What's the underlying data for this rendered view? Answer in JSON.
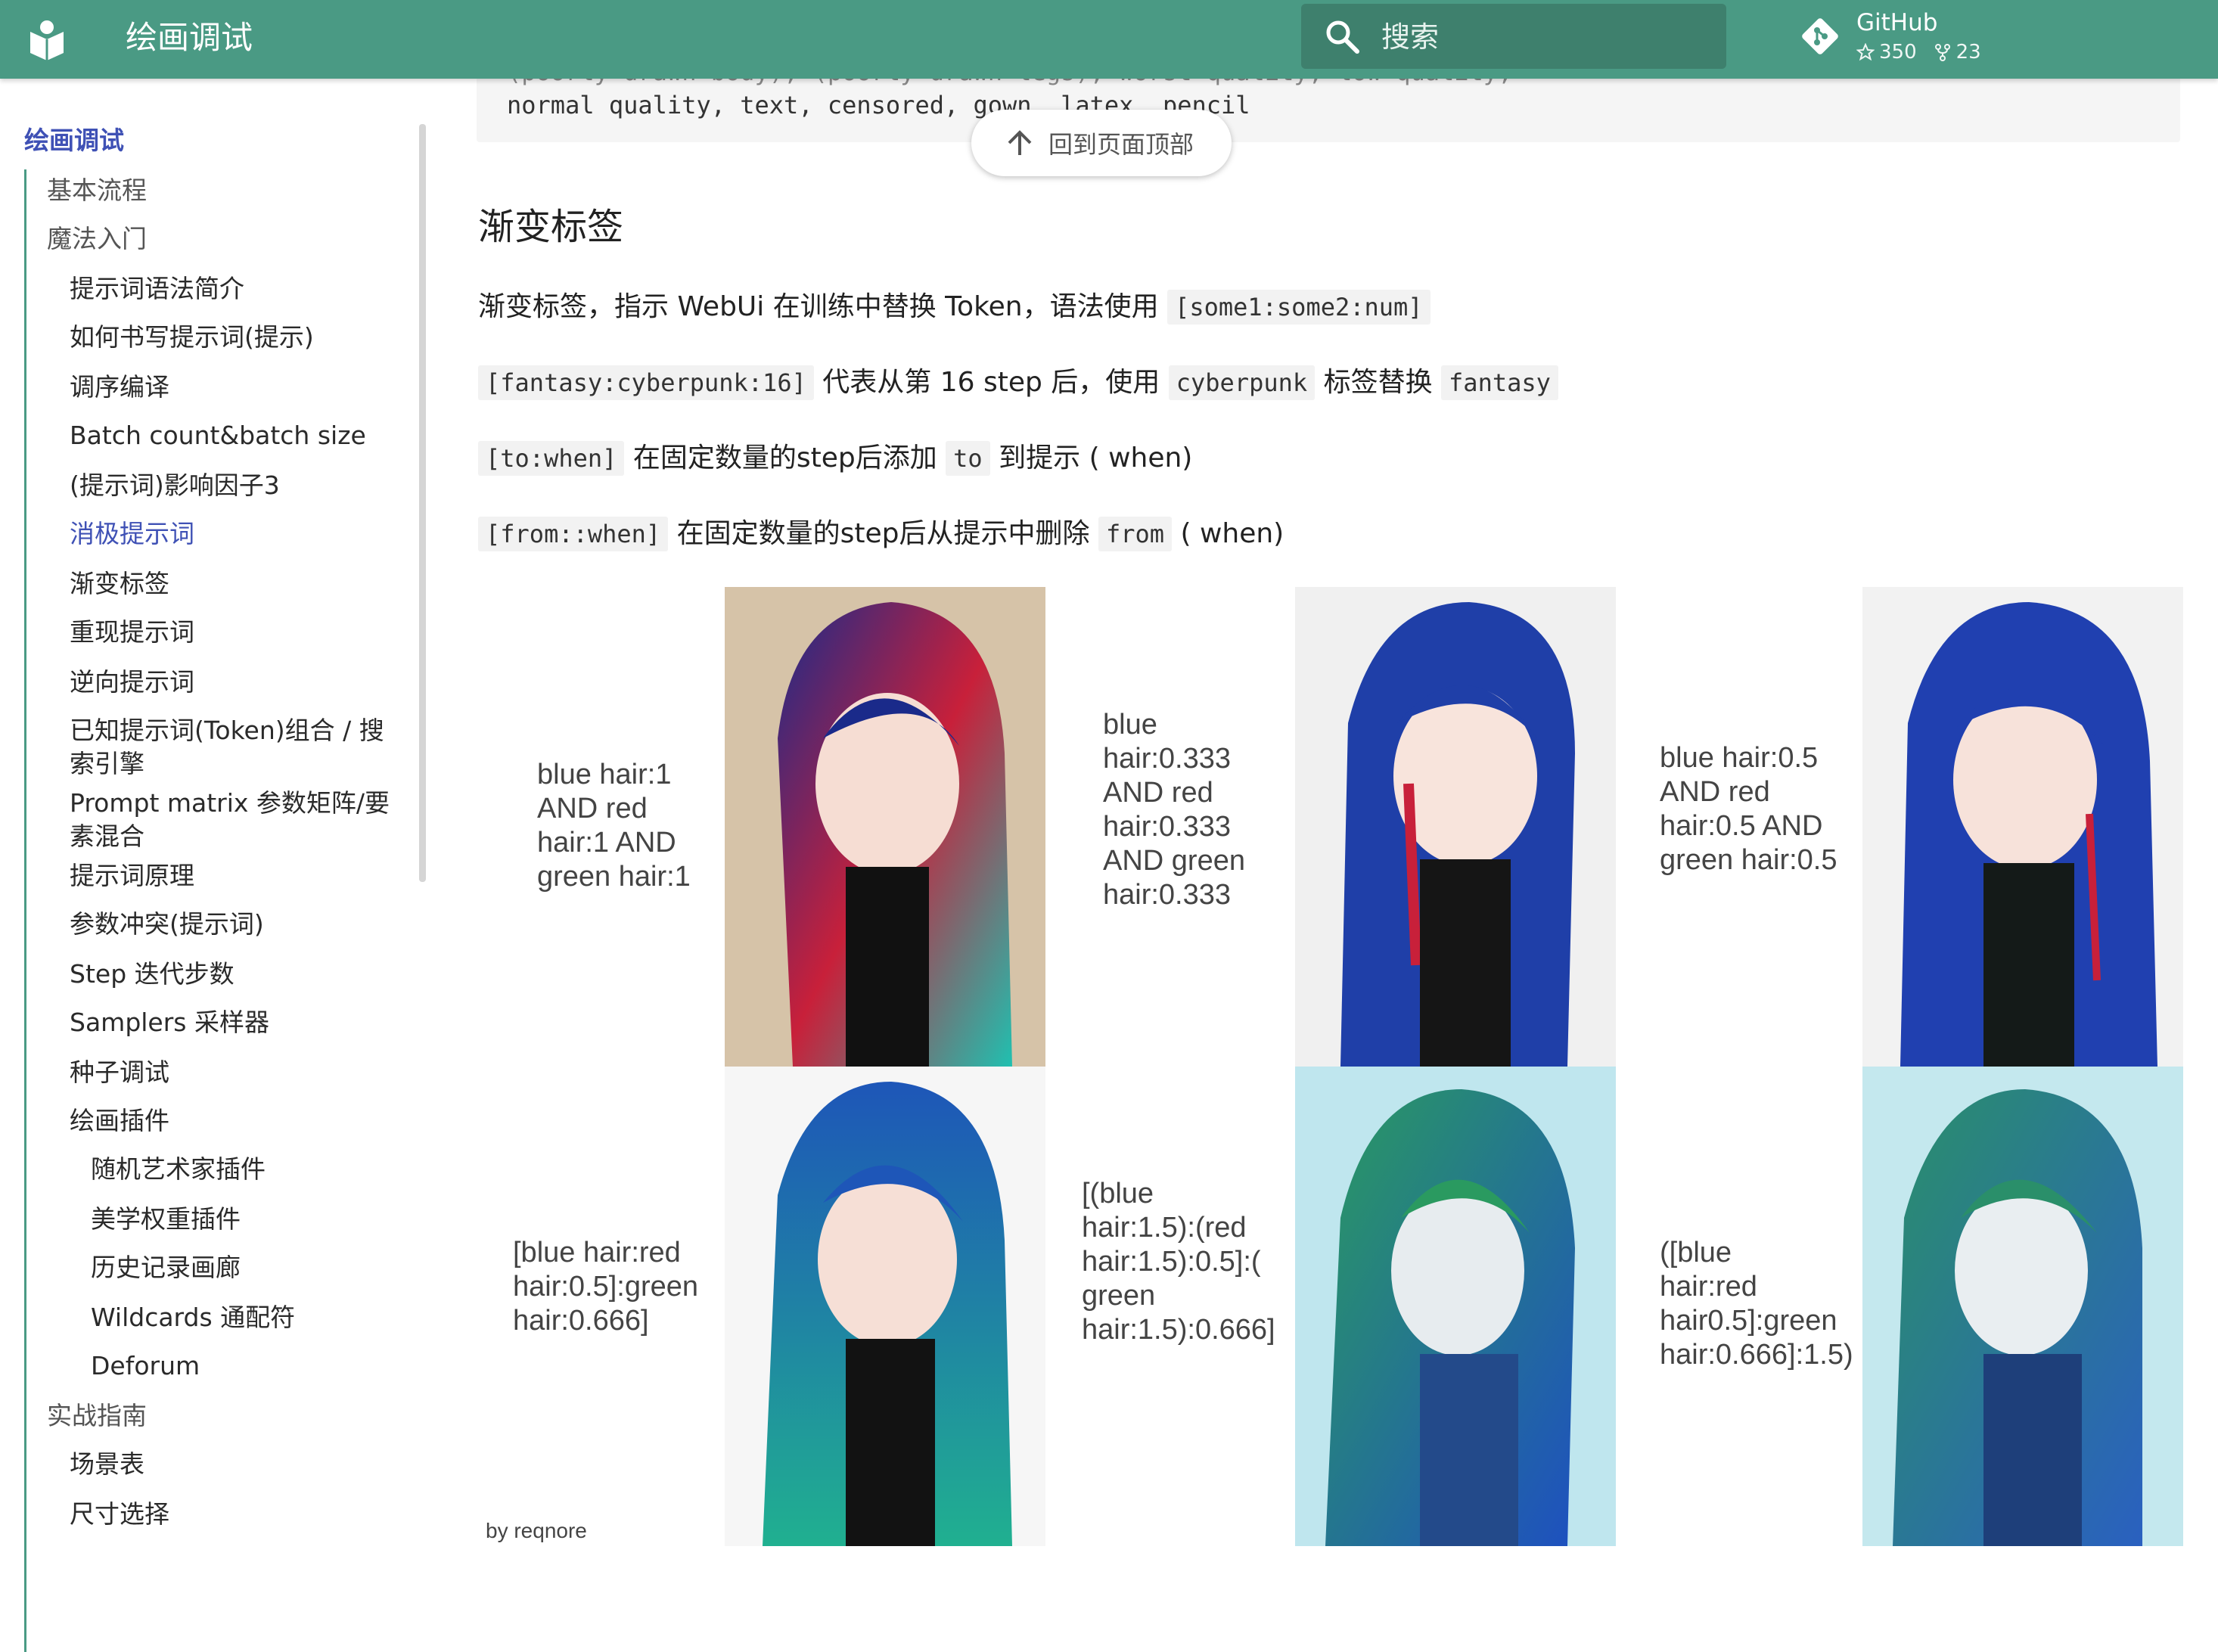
{
  "header": {
    "site_title": "绘画调试",
    "search_placeholder": "搜索",
    "repo": {
      "name": "GitHub",
      "stars": "350",
      "forks": "23"
    }
  },
  "sidebar": {
    "items": [
      {
        "label": "绘画调试",
        "level": 0,
        "active": true
      },
      {
        "label": "基本流程",
        "level": 1
      },
      {
        "label": "魔法入门",
        "level": 1
      },
      {
        "label": "提示词语法简介",
        "level": 2
      },
      {
        "label": "如何书写提示词(提示)",
        "level": 2
      },
      {
        "label": "调序编译",
        "level": 2
      },
      {
        "label": "Batch count&batch size",
        "level": 2
      },
      {
        "label": "(提示词)影响因子3",
        "level": 2
      },
      {
        "label": "消极提示词",
        "level": 2,
        "active": true
      },
      {
        "label": "渐变标签",
        "level": 2
      },
      {
        "label": "重现提示词",
        "level": 2
      },
      {
        "label": "逆向提示词",
        "level": 2
      },
      {
        "label": "已知提示词(Token)组合 / 搜索引擎",
        "level": 2
      },
      {
        "label": "Prompt matrix 参数矩阵/要素混合",
        "level": 2
      },
      {
        "label": "提示词原理",
        "level": 2
      },
      {
        "label": "参数冲突(提示词)",
        "level": 2
      },
      {
        "label": "Step 迭代步数",
        "level": 2
      },
      {
        "label": "Samplers 采样器",
        "level": 2
      },
      {
        "label": "种子调试",
        "level": 2
      },
      {
        "label": "绘画插件",
        "level": 2
      },
      {
        "label": "随机艺术家插件",
        "level": 3
      },
      {
        "label": "美学权重插件",
        "level": 3
      },
      {
        "label": "历史记录画廊",
        "level": 3
      },
      {
        "label": "Wildcards 通配符",
        "level": 3
      },
      {
        "label": "Deforum",
        "level": 3
      },
      {
        "label": "实战指南",
        "level": 1
      },
      {
        "label": "场景表",
        "level": 2
      },
      {
        "label": "尺寸选择",
        "level": 2
      }
    ]
  },
  "content": {
    "code_line_1": "(poorly drawn body), (poorly drawn legs), worst quality, low quality,",
    "code_line_2": "normal quality, text, censored, gown, latex, pencil",
    "back_to_top": "回到页面顶部",
    "section_heading": "渐变标签",
    "p1": {
      "text": "渐变标签，指示 WebUi 在训练中替换 Token，语法使用 ",
      "code": "[some1:some2:num]"
    },
    "p2": {
      "code1": "[fantasy:cyberpunk:16]",
      "text1": " 代表从第 16 step 后，使用 ",
      "code2": "cyberpunk",
      "text2": " 标签替换 ",
      "code3": "fantasy"
    },
    "p3": {
      "code1": "[to:when]",
      "text1": " 在固定数量的step后添加 ",
      "code2": "to",
      "text2": " 到提示 ( when)"
    },
    "p4": {
      "code1": "[from::when]",
      "text1": " 在固定数量的step后从提示中删除 ",
      "code2": "from",
      "text2": " ( when)"
    },
    "grid_labels": [
      "blue hair:1\nAND red\nhair:1 AND\ngreen hair:1",
      "blue\nhair:0.333\nAND red\nhair:0.333\nAND green\nhair:0.333",
      "blue hair:0.5\nAND red\nhair:0.5 AND\ngreen hair:0.5",
      "[blue hair:red\nhair:0.5]:green\nhair:0.666]",
      "[(blue\nhair:1.5):(red\nhair:1.5):0.5]:(\ngreen\nhair:1.5):0.666]",
      "([blue\nhair:red\nhair0.5]:green\nhair:0.666]:1.5)"
    ],
    "credit": "by reqnore"
  },
  "colors": {
    "header": "#4a9a84",
    "accent": "#3f51b5"
  }
}
